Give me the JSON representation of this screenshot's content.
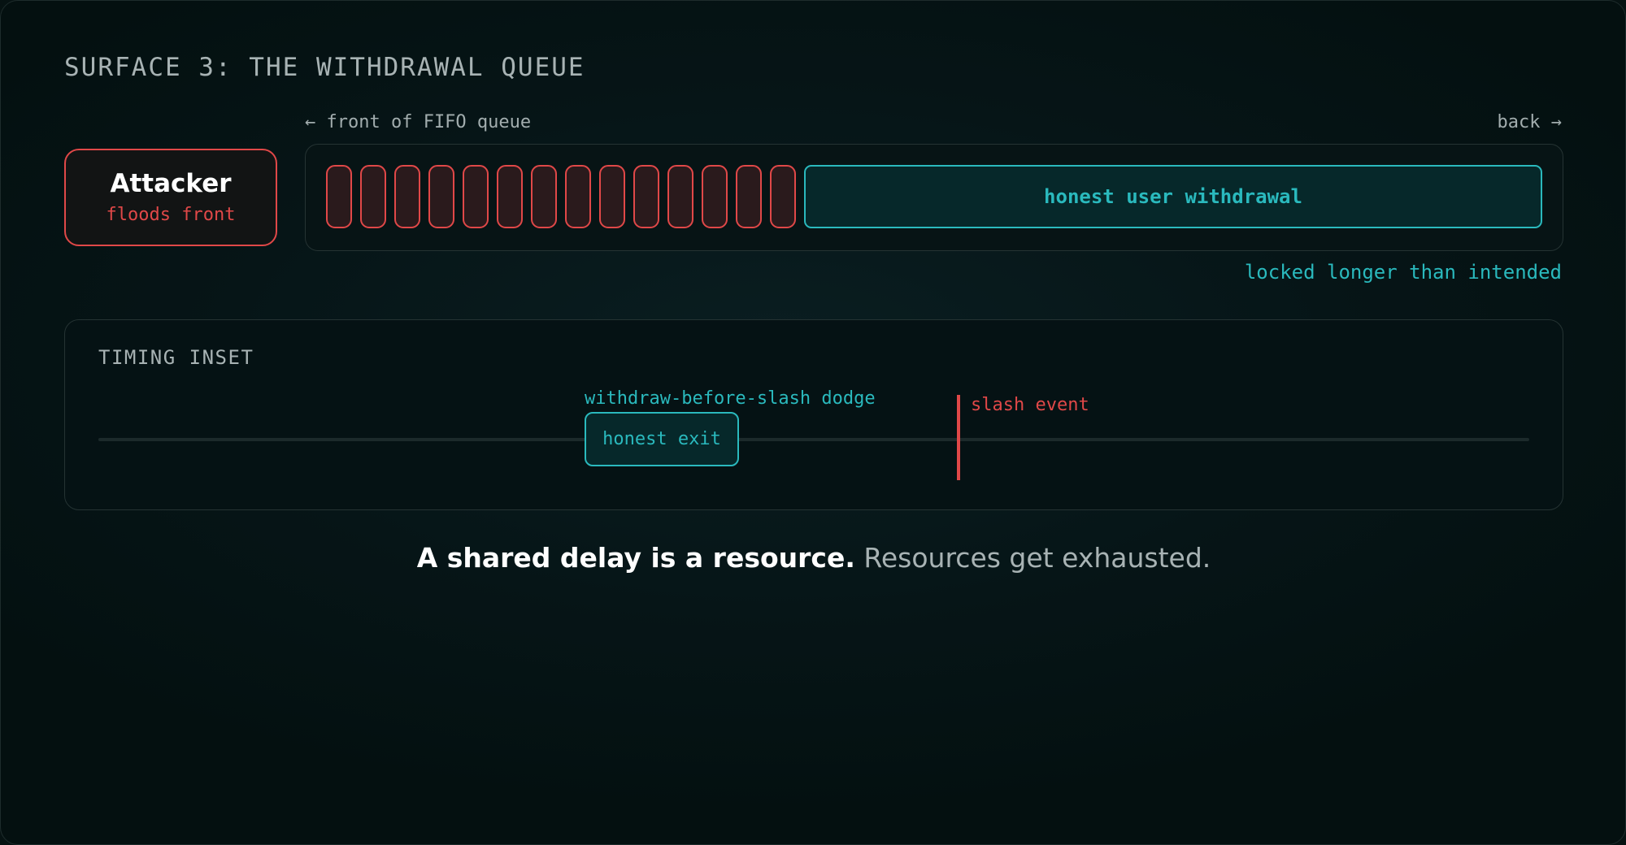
{
  "heading": "SURFACE 3: THE WITHDRAWAL QUEUE",
  "queue": {
    "front_label": "← front of FIFO queue",
    "back_label": "back →",
    "attacker_slot_count": 14,
    "honest_label": "honest user withdrawal",
    "locked_note": "locked longer than intended"
  },
  "attacker": {
    "title": "Attacker",
    "subtitle": "floods front"
  },
  "timing": {
    "title": "TIMING INSET",
    "dodge_label": "withdraw-before-slash dodge",
    "exit_label": "honest exit",
    "slash_label": "slash event"
  },
  "tagline": {
    "strong": "A shared delay is a resource.",
    "rest": "Resources get exhausted."
  },
  "colors": {
    "attacker_red": "#e04848",
    "honest_teal": "#2ab9bd",
    "background": "#061212"
  }
}
